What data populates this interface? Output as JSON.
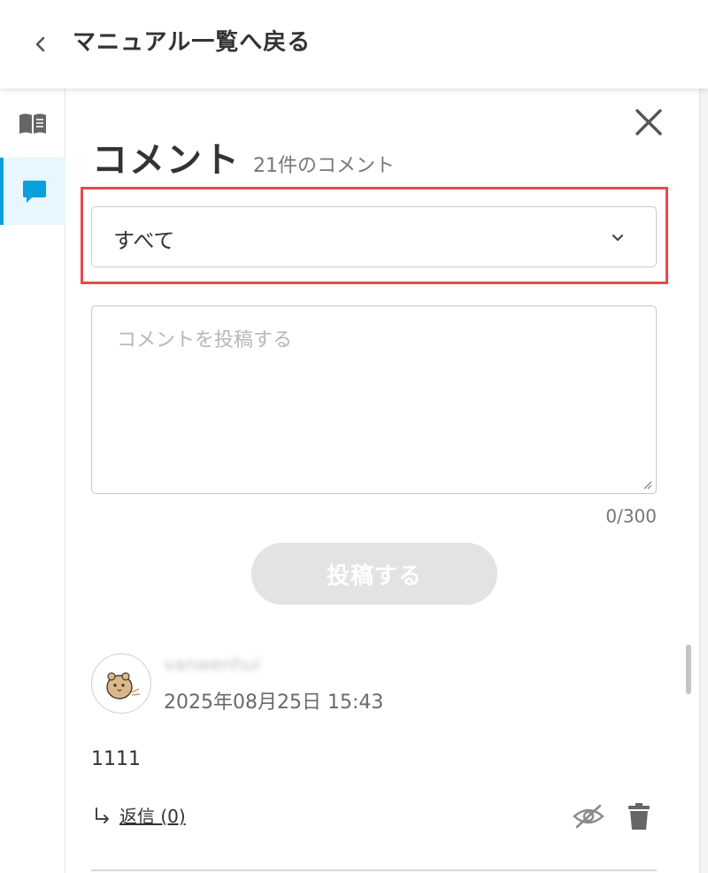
{
  "header": {
    "back_title": "マニュアル一覧へ戻る"
  },
  "sidebar": {
    "items": [
      {
        "name": "manual",
        "icon": "book-icon",
        "active": false
      },
      {
        "name": "comments",
        "icon": "comment-icon",
        "active": true
      }
    ]
  },
  "comments": {
    "title": "コメント",
    "count_label": "21件のコメント",
    "filter": {
      "selected": "すべて"
    },
    "input": {
      "placeholder": "コメントを投稿する",
      "char_count": "0/300"
    },
    "submit_label": "投稿する",
    "items": [
      {
        "username": "vanwenhui",
        "timestamp": "2025年08月25日 15:43",
        "body": "1111",
        "reply_label": "返信 (0)"
      }
    ]
  },
  "colors": {
    "accent": "#0aa0dc",
    "highlight": "#e8484d",
    "disabled_button": "#e3e3e3"
  }
}
